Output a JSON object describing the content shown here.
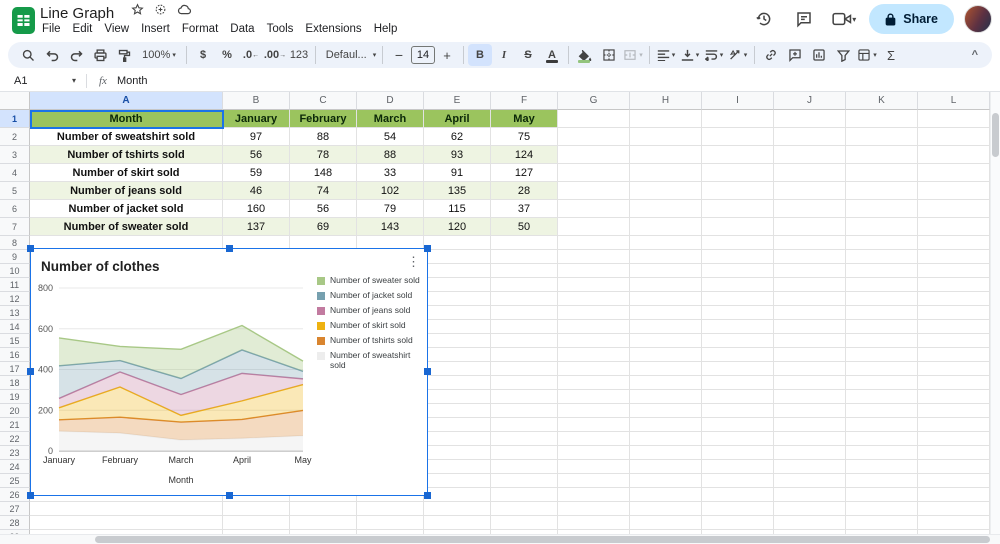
{
  "titlebar": {
    "doc_title": "Line Graph",
    "share_label": "Share",
    "icons": [
      "sheets-logo-icon",
      "star-icon",
      "move-folder-icon",
      "cloud-status-icon",
      "version-history-icon",
      "comments-icon",
      "meet-video-icon",
      "lock-icon",
      "avatar"
    ]
  },
  "menubar": [
    "File",
    "Edit",
    "View",
    "Insert",
    "Format",
    "Data",
    "Tools",
    "Extensions",
    "Help"
  ],
  "toolbar": {
    "zoom": "100%",
    "currency": "$",
    "percent": "%",
    "decrease_decimal": ".0",
    "increase_decimal": ".00",
    "number_format": "123",
    "font_name": "Defaul...",
    "font_size": "14",
    "bold": "B",
    "italic": "I",
    "strikethrough": "S",
    "text_color": "A",
    "functions": "Σ",
    "collapse": "^",
    "icons": [
      "search-icon",
      "undo-icon",
      "redo-icon",
      "print-icon",
      "paint-format-icon",
      "fill-color-icon",
      "borders-icon",
      "merge-cells-icon",
      "horizontal-align-icon",
      "vertical-align-icon",
      "text-wrap-icon",
      "text-rotate-icon",
      "link-icon",
      "insert-comment-icon",
      "insert-chart-icon",
      "filter-icon",
      "table-views-icon"
    ]
  },
  "formula_bar": {
    "cell_ref": "A1",
    "content": "Month"
  },
  "grid": {
    "columns": [
      "A",
      "B",
      "C",
      "D",
      "E",
      "F",
      "G",
      "H",
      "I",
      "J",
      "K",
      "L"
    ],
    "visible_rows": 29,
    "selected_cell": "A1",
    "table": {
      "header_row": [
        "Month",
        "January",
        "February",
        "March",
        "April",
        "May"
      ],
      "rows": [
        {
          "label": "Number of sweatshirt sold",
          "values": [
            97,
            88,
            54,
            62,
            75
          ]
        },
        {
          "label": "Number of tshirts sold",
          "values": [
            56,
            78,
            88,
            93,
            124
          ]
        },
        {
          "label": "Number of skirt sold",
          "values": [
            59,
            148,
            33,
            91,
            127
          ]
        },
        {
          "label": "Number of jeans sold",
          "values": [
            46,
            74,
            102,
            135,
            28
          ]
        },
        {
          "label": "Number of jacket sold",
          "values": [
            160,
            56,
            79,
            115,
            37
          ]
        },
        {
          "label": "Number of sweater sold",
          "values": [
            137,
            69,
            143,
            120,
            50
          ]
        }
      ]
    }
  },
  "chart_data": {
    "type": "area",
    "stacked": true,
    "title": "Number of clothes",
    "xlabel": "Month",
    "ylabel": "",
    "x": [
      "January",
      "February",
      "March",
      "April",
      "May"
    ],
    "ylim": [
      0,
      800
    ],
    "yticks": [
      0,
      200,
      400,
      600,
      800
    ],
    "grid": true,
    "legend_position": "right",
    "legend_order": "top_of_stack_first",
    "series_bottom_to_top": [
      {
        "name": "Number of sweatshirt sold",
        "color": "#ededed",
        "fill_opacity": 0.55,
        "values": [
          97,
          88,
          54,
          62,
          75
        ]
      },
      {
        "name": "Number of tshirts sold",
        "color": "#d9852f",
        "fill_opacity": 0.3,
        "values": [
          56,
          78,
          88,
          93,
          124
        ]
      },
      {
        "name": "Number of skirt sold",
        "color": "#eeb211",
        "fill_opacity": 0.3,
        "values": [
          59,
          148,
          33,
          91,
          127
        ]
      },
      {
        "name": "Number of jeans sold",
        "color": "#c27ba0",
        "fill_opacity": 0.3,
        "values": [
          46,
          74,
          102,
          135,
          28
        ]
      },
      {
        "name": "Number of jacket sold",
        "color": "#76a0af",
        "fill_opacity": 0.3,
        "values": [
          160,
          56,
          79,
          115,
          37
        ]
      },
      {
        "name": "Number of sweater sold",
        "color": "#a8c886",
        "fill_opacity": 0.35,
        "values": [
          137,
          69,
          143,
          120,
          50
        ]
      }
    ]
  },
  "colors": {
    "accent": "#1a73e8",
    "selection_handle": "#1967d2",
    "toolbar_bg": "#edf2fa",
    "share_bg": "#c2e7ff",
    "share_text": "#001d35",
    "header_row_green": "#9bc45e",
    "banded_row_green": "#eef4e2",
    "logo_green": "#159a49",
    "selected_header_blue": "#d3e3fd"
  }
}
